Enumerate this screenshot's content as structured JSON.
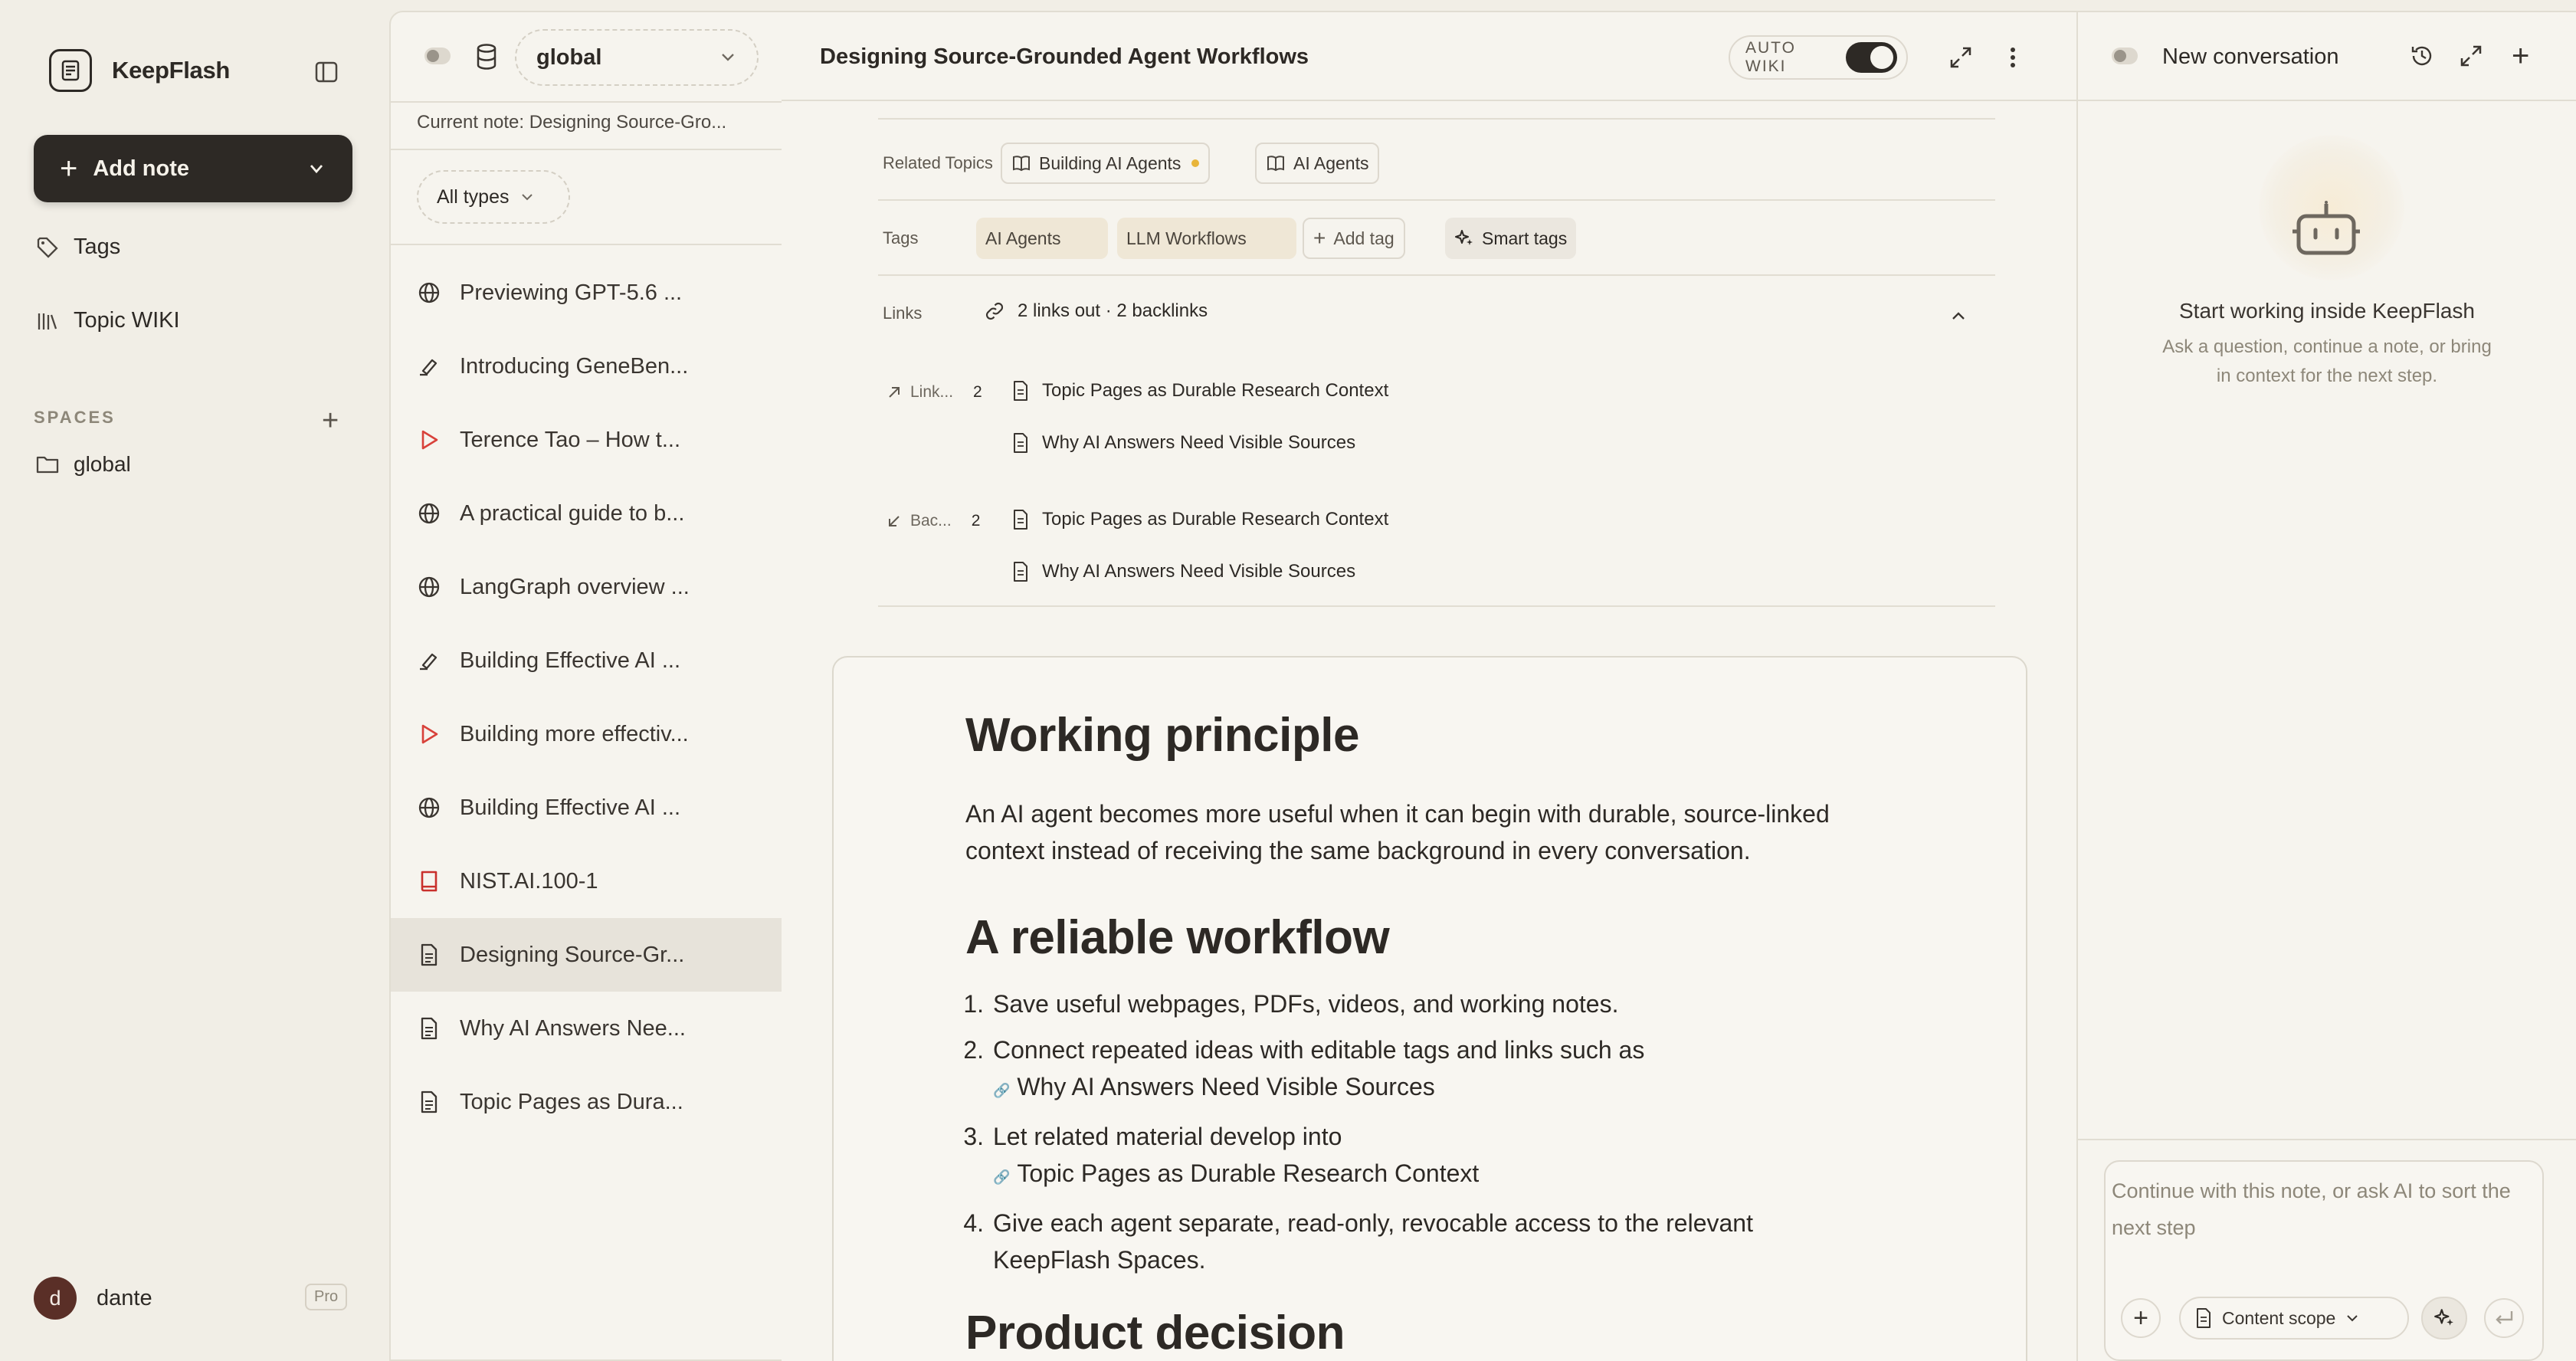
{
  "app": {
    "name": "KeepFlash"
  },
  "sidebar": {
    "add_note_label": "Add note",
    "nav": [
      {
        "label": "Tags",
        "icon": "tag-icon"
      },
      {
        "label": "Topic WIKI",
        "icon": "library-icon"
      }
    ],
    "spaces_heading": "SPACES",
    "spaces": [
      {
        "label": "global",
        "icon": "folder-icon"
      }
    ],
    "user": {
      "initial": "d",
      "name": "dante",
      "plan": "Pro"
    }
  },
  "list": {
    "space": "global",
    "current_note": "Current note: Designing Source-Gro...",
    "filter": "All types",
    "items": [
      {
        "label": "Previewing GPT-5.6 ...",
        "icon": "globe-icon"
      },
      {
        "label": "Introducing GeneBen...",
        "icon": "highlighter-icon"
      },
      {
        "label": "Terence Tao – How t...",
        "icon": "play-icon"
      },
      {
        "label": "A practical guide to b...",
        "icon": "globe-icon"
      },
      {
        "label": "LangGraph overview ...",
        "icon": "globe-icon"
      },
      {
        "label": "Building Effective AI ...",
        "icon": "highlighter-icon"
      },
      {
        "label": "Building more effectiv...",
        "icon": "play-icon"
      },
      {
        "label": "Building Effective AI ...",
        "icon": "globe-icon"
      },
      {
        "label": "NIST.AI.100-1",
        "icon": "book-icon"
      },
      {
        "label": "Designing Source-Gr...",
        "icon": "document-icon",
        "selected": true
      },
      {
        "label": "Why AI Answers Nee...",
        "icon": "document-icon"
      },
      {
        "label": "Topic Pages as Dura...",
        "icon": "document-icon"
      }
    ]
  },
  "note": {
    "title": "Designing Source-Grounded Agent Workflows",
    "auto_wiki_label": "AUTO WIKI",
    "auto_wiki_on": true,
    "related_label": "Related Topics",
    "related_topics": [
      {
        "label": "Building AI Agents",
        "dot_color": "#e8b53a"
      },
      {
        "label": "AI Agents"
      }
    ],
    "tags_label": "Tags",
    "tags": [
      "AI Agents",
      "LLM Workflows"
    ],
    "add_tag_label": "Add tag",
    "smart_tags_label": "Smart tags",
    "links_label": "Links",
    "links_summary": "2 links out · 2 backlinks",
    "links_out": {
      "label": "Link...",
      "count": "2",
      "items": [
        "Topic Pages as Durable Research Context",
        "Why AI Answers Need Visible Sources"
      ]
    },
    "backlinks": {
      "label": "Bac...",
      "count": "2",
      "items": [
        "Topic Pages as Durable Research Context",
        "Why AI Answers Need Visible Sources"
      ]
    },
    "body": {
      "h1": "Working principle",
      "p1": "An AI agent becomes more useful when it can begin with durable, source-linked context instead of receiving the same background in every conversation.",
      "h2": "A reliable workflow",
      "steps": [
        {
          "n": "1.",
          "text": "Save useful webpages, PDFs, videos, and working notes."
        },
        {
          "n": "2.",
          "text": "Connect repeated ideas with editable tags and links such as",
          "link": "Why AI Answers Need Visible Sources"
        },
        {
          "n": "3.",
          "text": "Let related material develop into",
          "link": "Topic Pages as Durable Research Context"
        },
        {
          "n": "4.",
          "text": "Give each agent separate, read-only, revocable access to the relevant KeepFlash Spaces."
        }
      ],
      "h3": "Product decision"
    }
  },
  "chat": {
    "title": "New conversation",
    "empty_title": "Start working inside KeepFlash",
    "empty_sub": "Ask a question, continue a note, or bring in context for the next step.",
    "input_placeholder": "Continue with this note, or ask AI to sort the next step",
    "scope_label": "Content scope"
  },
  "colors": {
    "primary": "#2d2925",
    "background": "#f1eee6",
    "panel": "#f6f4ee",
    "accent_dot": "#e8b53a",
    "video_red": "#d8413a",
    "pdf_red": "#c9302c"
  }
}
